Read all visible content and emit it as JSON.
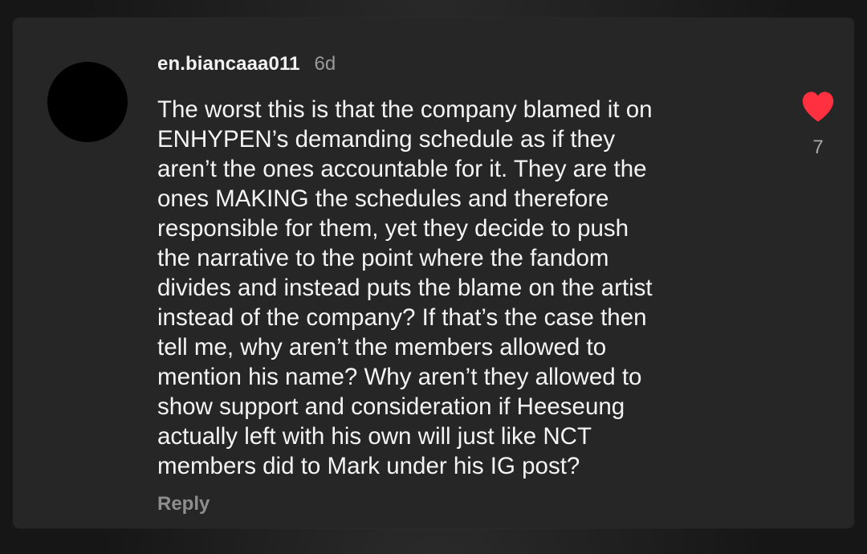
{
  "comment": {
    "username": "en.biancaaa011",
    "time_ago": "6d",
    "lines": [
      "The worst this is that the company blamed it on",
      "ENHYPEN’s demanding schedule as if they",
      "aren’t the ones accountable for it. They are the",
      "ones MAKING the schedules and therefore",
      "responsible for them, yet they decide to push",
      "the narrative to the point where the fandom",
      "divides and instead puts the blame on the artist",
      "instead of the company? If that’s the case then",
      "tell me, why aren’t the members allowed to",
      "mention his name? Why aren’t they allowed to",
      "show support and consideration if Heeseung",
      "actually left with his own will just like NCT",
      "members did to Mark under his IG post?"
    ],
    "reply_label": "Reply",
    "like_count": "7",
    "like_icon": "heart-icon",
    "liked": true
  },
  "colors": {
    "card_bg": "#262626",
    "heart": "#ff3040",
    "text": "#f4f4f4",
    "muted": "#9a9a9a"
  }
}
